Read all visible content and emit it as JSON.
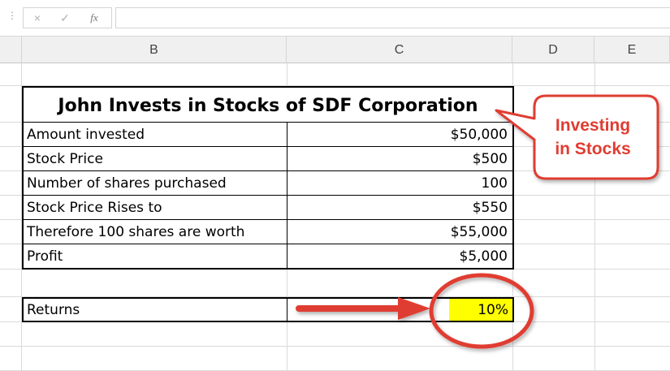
{
  "formula_bar": {
    "cancel_icon": "×",
    "enter_icon": "✓",
    "function_icon": "fx",
    "formula_value": ""
  },
  "columns": [
    "B",
    "C",
    "D",
    "E"
  ],
  "table": {
    "title": "John Invests in Stocks of SDF Corporation",
    "rows": [
      {
        "label": "Amount invested",
        "value": "$50,000"
      },
      {
        "label": "Stock Price",
        "value": "$500"
      },
      {
        "label": "Number of shares purchased",
        "value": "100"
      },
      {
        "label": "Stock Price Rises to",
        "value": "$550"
      },
      {
        "label": "Therefore 100 shares are worth",
        "value": "$55,000"
      },
      {
        "label": "Profit",
        "value": "$5,000"
      }
    ]
  },
  "returns": {
    "label": "Returns",
    "value": "10%",
    "highlight_color": "#ffff00"
  },
  "callout": {
    "line1": "Investing",
    "line2": "in Stocks",
    "color": "#e03c31"
  }
}
